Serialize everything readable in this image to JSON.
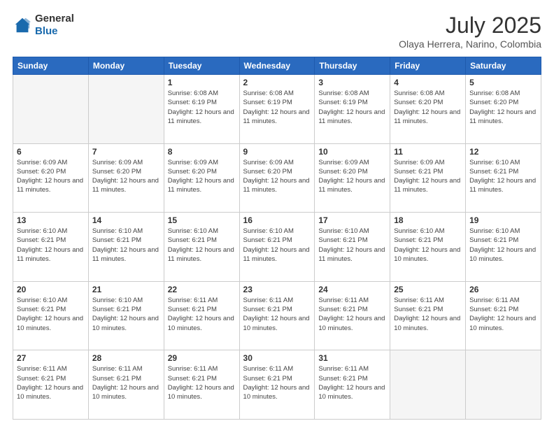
{
  "header": {
    "logo": {
      "line1": "General",
      "line2": "Blue"
    },
    "title": "July 2025",
    "location": "Olaya Herrera, Narino, Colombia"
  },
  "weekdays": [
    "Sunday",
    "Monday",
    "Tuesday",
    "Wednesday",
    "Thursday",
    "Friday",
    "Saturday"
  ],
  "weeks": [
    [
      {
        "day": "",
        "info": ""
      },
      {
        "day": "",
        "info": ""
      },
      {
        "day": "1",
        "info": "Sunrise: 6:08 AM\nSunset: 6:19 PM\nDaylight: 12 hours and 11 minutes."
      },
      {
        "day": "2",
        "info": "Sunrise: 6:08 AM\nSunset: 6:19 PM\nDaylight: 12 hours and 11 minutes."
      },
      {
        "day": "3",
        "info": "Sunrise: 6:08 AM\nSunset: 6:19 PM\nDaylight: 12 hours and 11 minutes."
      },
      {
        "day": "4",
        "info": "Sunrise: 6:08 AM\nSunset: 6:20 PM\nDaylight: 12 hours and 11 minutes."
      },
      {
        "day": "5",
        "info": "Sunrise: 6:08 AM\nSunset: 6:20 PM\nDaylight: 12 hours and 11 minutes."
      }
    ],
    [
      {
        "day": "6",
        "info": "Sunrise: 6:09 AM\nSunset: 6:20 PM\nDaylight: 12 hours and 11 minutes."
      },
      {
        "day": "7",
        "info": "Sunrise: 6:09 AM\nSunset: 6:20 PM\nDaylight: 12 hours and 11 minutes."
      },
      {
        "day": "8",
        "info": "Sunrise: 6:09 AM\nSunset: 6:20 PM\nDaylight: 12 hours and 11 minutes."
      },
      {
        "day": "9",
        "info": "Sunrise: 6:09 AM\nSunset: 6:20 PM\nDaylight: 12 hours and 11 minutes."
      },
      {
        "day": "10",
        "info": "Sunrise: 6:09 AM\nSunset: 6:20 PM\nDaylight: 12 hours and 11 minutes."
      },
      {
        "day": "11",
        "info": "Sunrise: 6:09 AM\nSunset: 6:21 PM\nDaylight: 12 hours and 11 minutes."
      },
      {
        "day": "12",
        "info": "Sunrise: 6:10 AM\nSunset: 6:21 PM\nDaylight: 12 hours and 11 minutes."
      }
    ],
    [
      {
        "day": "13",
        "info": "Sunrise: 6:10 AM\nSunset: 6:21 PM\nDaylight: 12 hours and 11 minutes."
      },
      {
        "day": "14",
        "info": "Sunrise: 6:10 AM\nSunset: 6:21 PM\nDaylight: 12 hours and 11 minutes."
      },
      {
        "day": "15",
        "info": "Sunrise: 6:10 AM\nSunset: 6:21 PM\nDaylight: 12 hours and 11 minutes."
      },
      {
        "day": "16",
        "info": "Sunrise: 6:10 AM\nSunset: 6:21 PM\nDaylight: 12 hours and 11 minutes."
      },
      {
        "day": "17",
        "info": "Sunrise: 6:10 AM\nSunset: 6:21 PM\nDaylight: 12 hours and 11 minutes."
      },
      {
        "day": "18",
        "info": "Sunrise: 6:10 AM\nSunset: 6:21 PM\nDaylight: 12 hours and 10 minutes."
      },
      {
        "day": "19",
        "info": "Sunrise: 6:10 AM\nSunset: 6:21 PM\nDaylight: 12 hours and 10 minutes."
      }
    ],
    [
      {
        "day": "20",
        "info": "Sunrise: 6:10 AM\nSunset: 6:21 PM\nDaylight: 12 hours and 10 minutes."
      },
      {
        "day": "21",
        "info": "Sunrise: 6:10 AM\nSunset: 6:21 PM\nDaylight: 12 hours and 10 minutes."
      },
      {
        "day": "22",
        "info": "Sunrise: 6:11 AM\nSunset: 6:21 PM\nDaylight: 12 hours and 10 minutes."
      },
      {
        "day": "23",
        "info": "Sunrise: 6:11 AM\nSunset: 6:21 PM\nDaylight: 12 hours and 10 minutes."
      },
      {
        "day": "24",
        "info": "Sunrise: 6:11 AM\nSunset: 6:21 PM\nDaylight: 12 hours and 10 minutes."
      },
      {
        "day": "25",
        "info": "Sunrise: 6:11 AM\nSunset: 6:21 PM\nDaylight: 12 hours and 10 minutes."
      },
      {
        "day": "26",
        "info": "Sunrise: 6:11 AM\nSunset: 6:21 PM\nDaylight: 12 hours and 10 minutes."
      }
    ],
    [
      {
        "day": "27",
        "info": "Sunrise: 6:11 AM\nSunset: 6:21 PM\nDaylight: 12 hours and 10 minutes."
      },
      {
        "day": "28",
        "info": "Sunrise: 6:11 AM\nSunset: 6:21 PM\nDaylight: 12 hours and 10 minutes."
      },
      {
        "day": "29",
        "info": "Sunrise: 6:11 AM\nSunset: 6:21 PM\nDaylight: 12 hours and 10 minutes."
      },
      {
        "day": "30",
        "info": "Sunrise: 6:11 AM\nSunset: 6:21 PM\nDaylight: 12 hours and 10 minutes."
      },
      {
        "day": "31",
        "info": "Sunrise: 6:11 AM\nSunset: 6:21 PM\nDaylight: 12 hours and 10 minutes."
      },
      {
        "day": "",
        "info": ""
      },
      {
        "day": "",
        "info": ""
      }
    ]
  ]
}
